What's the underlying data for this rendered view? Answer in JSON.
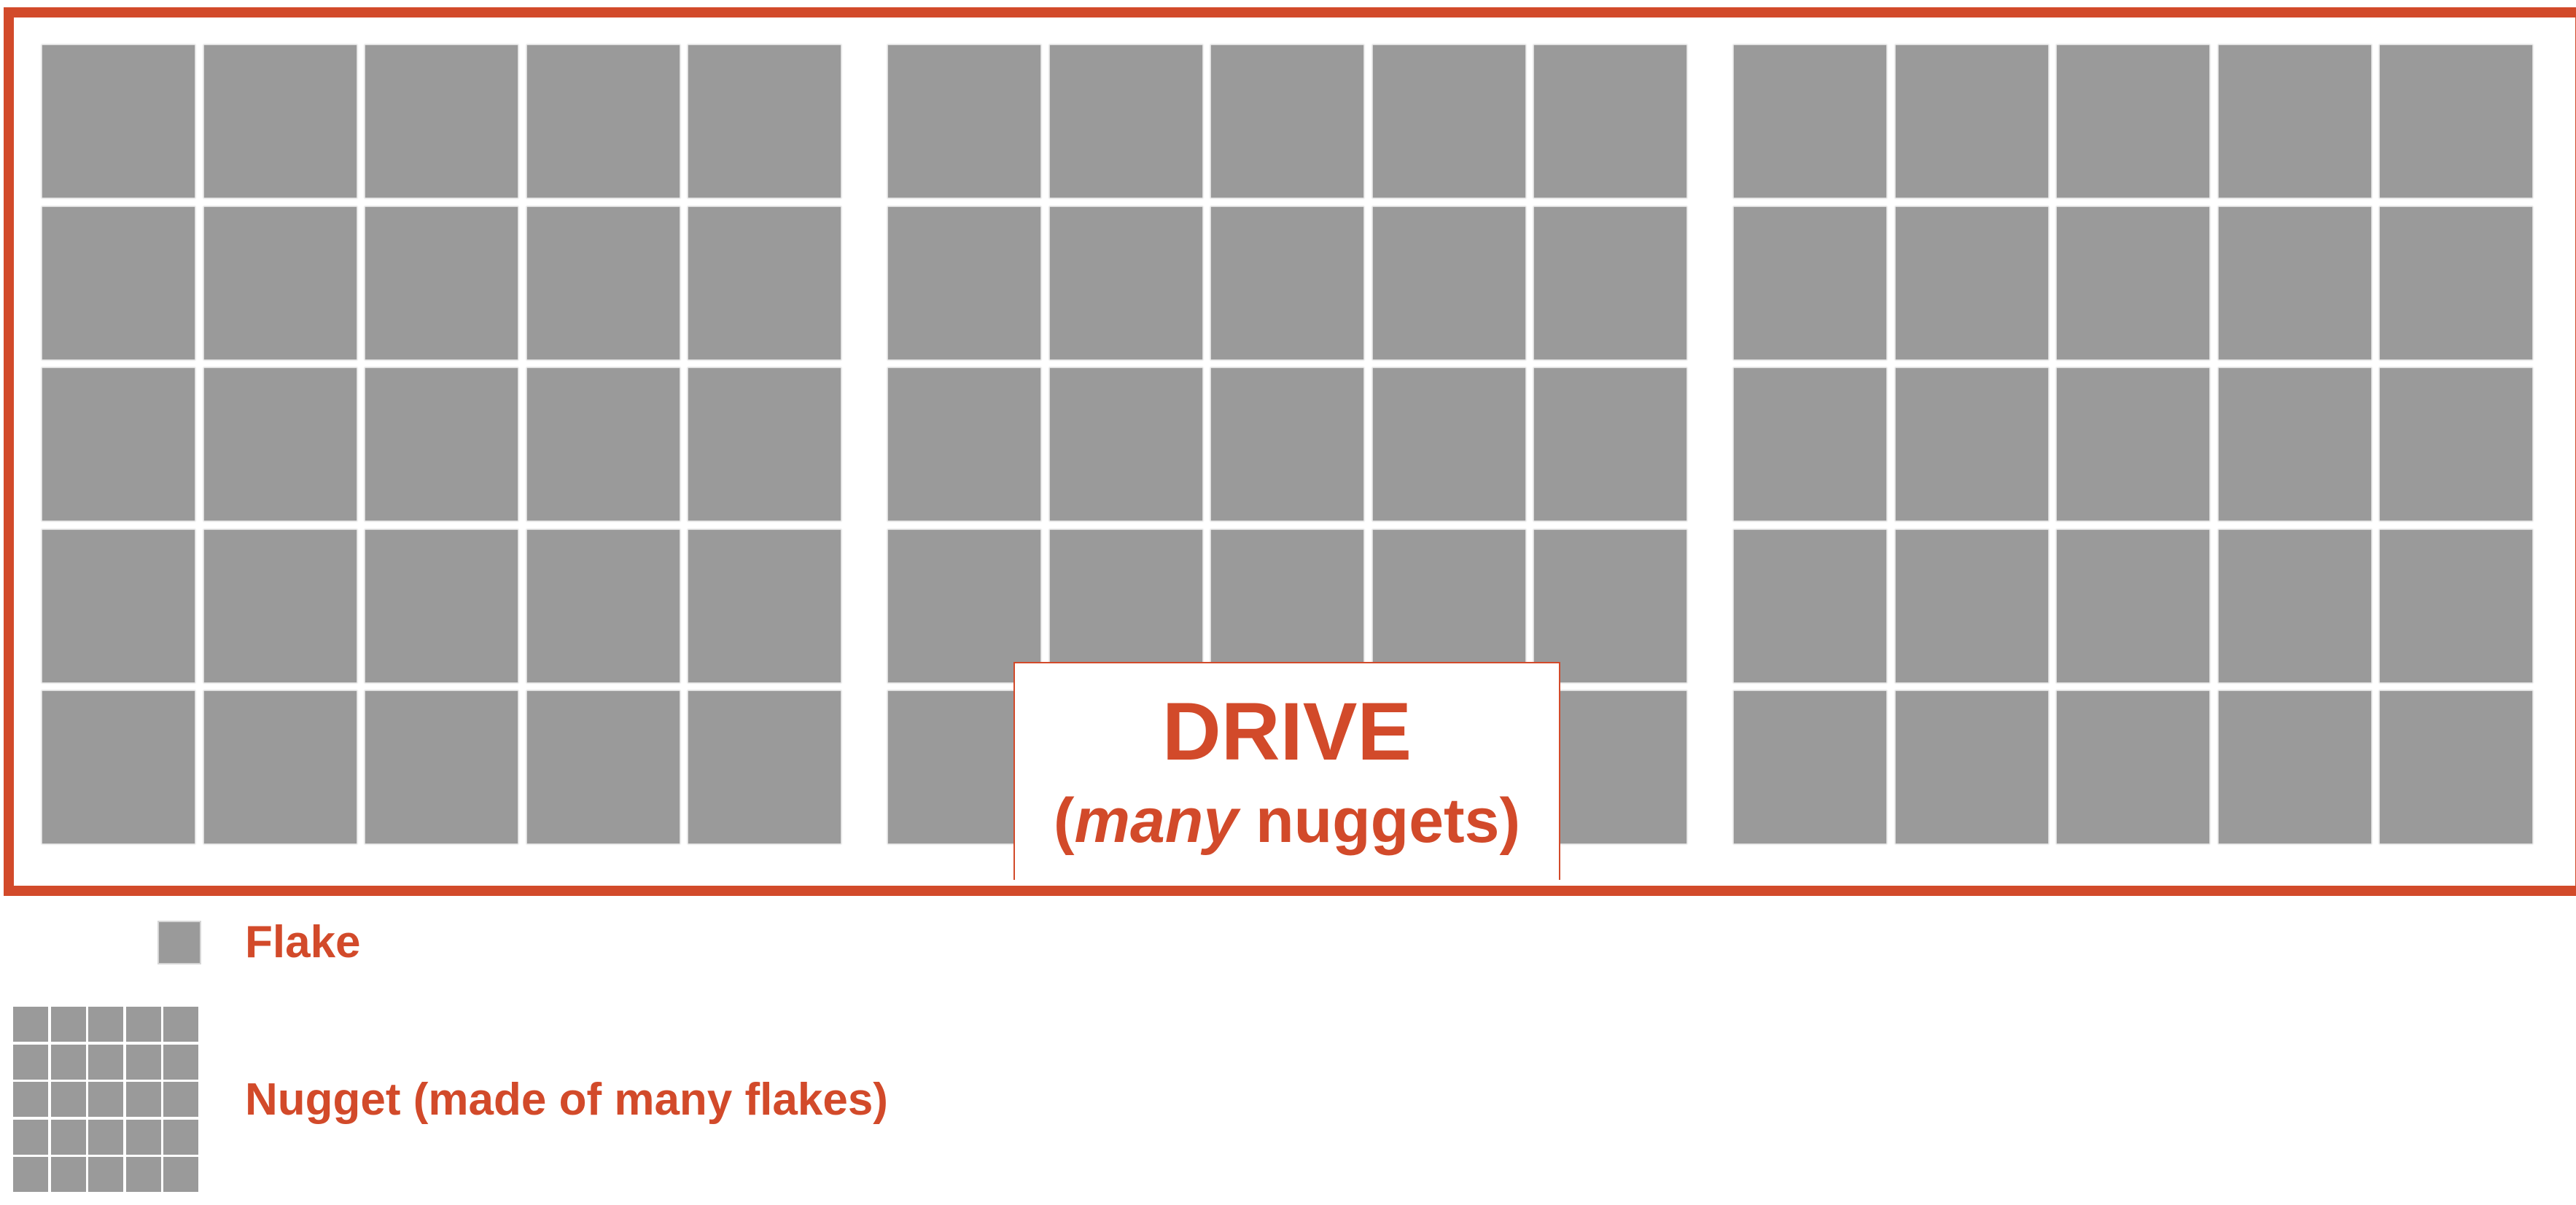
{
  "colors": {
    "accent": "#D24A2A",
    "flake_gray": "#9a9a9a",
    "background": "#ffffff"
  },
  "drive": {
    "title": "DRIVE",
    "subtitle_prefix": "(",
    "subtitle_emphasis": "many",
    "subtitle_rest": " nuggets)",
    "nugget_count": 3,
    "flake_grid": {
      "rows": 5,
      "cols": 5
    }
  },
  "legend": {
    "flake_label": "Flake",
    "nugget_label": "Nugget (made of many flakes)"
  }
}
